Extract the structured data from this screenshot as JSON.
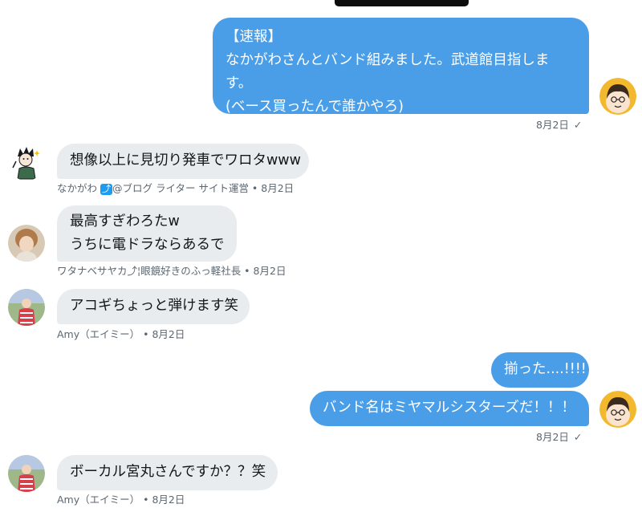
{
  "messages": [
    {
      "lines": [
        "【速報】",
        "なかがわさんとバンド組みました。武道館目指しま",
        "す。",
        "(ベース買ったんで誰かやろ)"
      ],
      "meta": "8月2日",
      "read_mark": "✓"
    },
    {
      "lines": [
        "想像以上に見切り発車でワロタwww"
      ],
      "meta_name": "なかがわ",
      "meta_badge": "⤴",
      "meta_rest": "@ブログ ライター サイト運営 • 8月2日"
    },
    {
      "lines": [
        "最高すぎわろたw",
        "うちに電ドラならあるで"
      ],
      "meta": "ワタナベサヤカ⤴︎¦眼鏡好きのふっ軽社長 • 8月2日"
    },
    {
      "lines": [
        "アコギちょっと弾けます笑"
      ],
      "meta": "Amy（エイミー） • 8月2日"
    },
    {
      "lines": [
        "揃った....!!!!"
      ]
    },
    {
      "lines": [
        "バンド名はミヤマルシスターズだ！！！"
      ],
      "meta": "8月2日",
      "read_mark": "✓"
    },
    {
      "lines": [
        "ボーカル宮丸さんですか？？笑"
      ],
      "meta": "Amy（エイミー） • 8月2日"
    }
  ],
  "colors": {
    "outgoing_bubble": "#4a9ee8",
    "incoming_bubble": "#e8ecef",
    "meta_text": "#5b6670"
  },
  "icons": {
    "self_avatar": "self-avatar",
    "nakagawa_avatar": "illustrated-avatar",
    "watanabe_avatar": "photo-avatar",
    "amy_avatar": "photo-avatar"
  }
}
